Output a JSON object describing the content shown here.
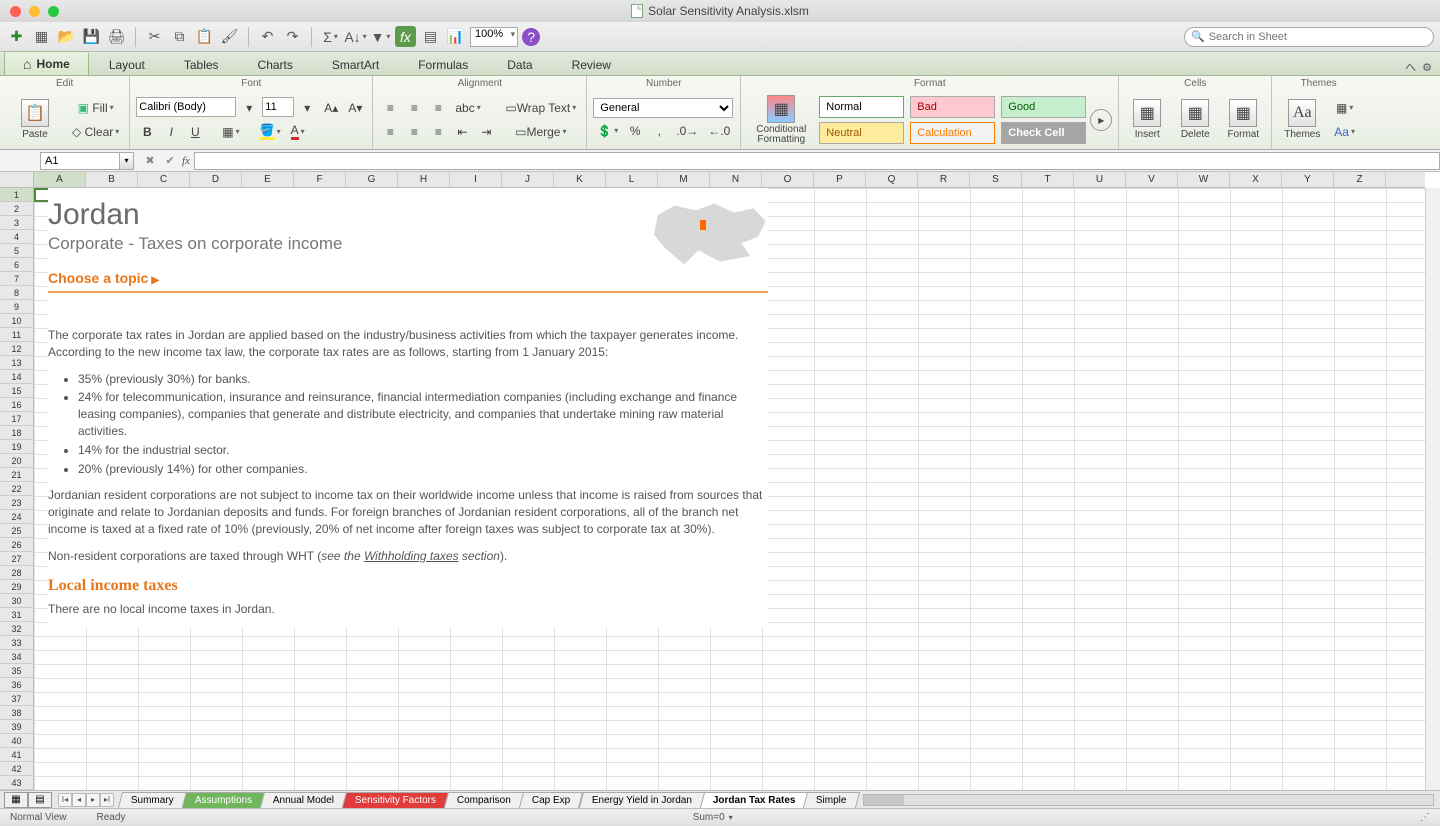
{
  "window": {
    "title": "Solar Sensitivity Analysis.xlsm"
  },
  "quickbar": {
    "zoom": "100%",
    "search_placeholder": "Search in Sheet"
  },
  "ribbon_tabs": {
    "home": "Home",
    "layout": "Layout",
    "tables": "Tables",
    "charts": "Charts",
    "smartart": "SmartArt",
    "formulas": "Formulas",
    "data": "Data",
    "review": "Review"
  },
  "ribbon": {
    "groups": {
      "edit": "Edit",
      "font": "Font",
      "alignment": "Alignment",
      "number": "Number",
      "format": "Format",
      "cells": "Cells",
      "themes": "Themes"
    },
    "paste": "Paste",
    "fill": "Fill",
    "clear": "Clear",
    "font_name": "Calibri (Body)",
    "font_size": "11",
    "wrap": "Wrap Text",
    "merge": "Merge",
    "number_format": "General",
    "cond_fmt": "Conditional\nFormatting",
    "styles": {
      "normal": "Normal",
      "bad": "Bad",
      "good": "Good",
      "neutral": "Neutral",
      "calc": "Calculation",
      "check": "Check Cell"
    },
    "insert": "Insert",
    "delete": "Delete",
    "format_btn": "Format",
    "themes": "Themes"
  },
  "formula_bar": {
    "cell_ref": "A1"
  },
  "columns": [
    "A",
    "B",
    "C",
    "D",
    "E",
    "F",
    "G",
    "H",
    "I",
    "J",
    "K",
    "L",
    "M",
    "N",
    "O",
    "P",
    "Q",
    "R",
    "S",
    "T",
    "U",
    "V",
    "W",
    "X",
    "Y",
    "Z"
  ],
  "doc": {
    "title": "Jordan",
    "subtitle": "Corporate - Taxes on corporate income",
    "choose": "Choose a topic",
    "p1": "The corporate tax rates in Jordan are applied based on the industry/business activities from which the taxpayer generates income. According to the new income tax law, the corporate tax rates are as follows, starting from 1 January 2015:",
    "bullets": [
      "35% (previously 30%) for banks.",
      "24% for telecommunication, insurance and reinsurance, financial intermediation companies (including exchange and finance leasing companies), companies that generate and distribute electricity, and companies that undertake mining raw material activities.",
      "14% for the industrial sector.",
      "20% (previously 14%) for other companies."
    ],
    "p2": "Jordanian resident corporations are not subject to income tax on their worldwide income unless that income is raised from sources that originate and relate to Jordanian deposits and funds. For foreign branches of Jordanian resident corporations, all of the branch net income is taxed at a fixed rate of 10% (previously, 20% of net income after foreign taxes was subject to corporate tax at 30%).",
    "p3a": "Non-resident corporations are taxed through WHT (",
    "p3b": "see the ",
    "p3c": "Withholding taxes",
    "p3d": " section",
    "p3e": ").",
    "h2": "Local income taxes",
    "p4": "There are no local income taxes in Jordan."
  },
  "sheets": [
    "Summary",
    "Assumptions",
    "Annual Model",
    "Sensitivity Factors",
    "Comparison",
    "Cap Exp",
    "Energy Yield in Jordan",
    "Jordan Tax Rates",
    "Simple"
  ],
  "sheet_colors": [
    "",
    "st-green",
    "",
    "st-red",
    "",
    "",
    "",
    "st-active",
    ""
  ],
  "status": {
    "view": "Normal View",
    "ready": "Ready",
    "sum": "Sum=0"
  }
}
